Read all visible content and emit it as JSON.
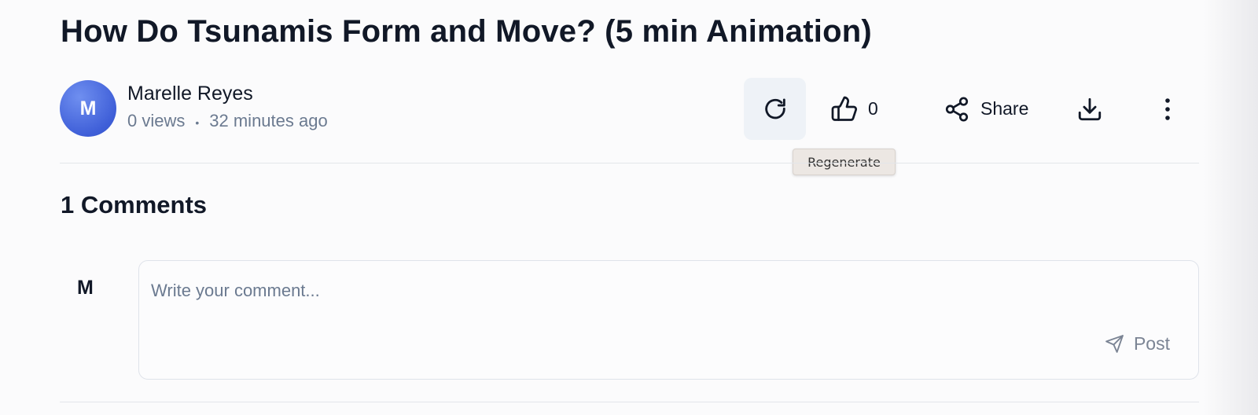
{
  "video": {
    "title": "How Do Tsunamis Form and Move? (5 min Animation)"
  },
  "author": {
    "initial": "M",
    "name": "Marelle Reyes",
    "views": "0 views",
    "separator": "•",
    "posted": "32 minutes ago"
  },
  "actions": {
    "regenerate_icon": "refresh-icon",
    "like_icon": "thumbs-up-icon",
    "like_count": "0",
    "share_icon": "share-icon",
    "share_label": "Share",
    "download_icon": "download-icon",
    "more_icon": "vertical-dots-icon"
  },
  "tooltip": {
    "text": "Regenerate"
  },
  "comments": {
    "heading": "1 Comments",
    "user_initial": "M",
    "placeholder": "Write your comment...",
    "value": "",
    "post_icon": "send-icon",
    "post_label": "Post"
  },
  "colors": {
    "avatar": "#4a6ae0",
    "active_button_bg": "#eef2f7",
    "muted_text": "#6b7a90",
    "tooltip_bg": "#ece7e3"
  }
}
